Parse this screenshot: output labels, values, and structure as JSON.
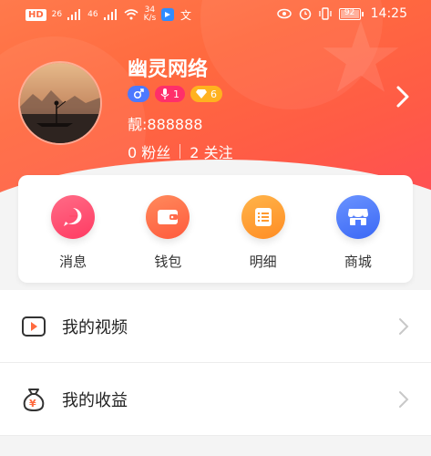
{
  "status_bar": {
    "hd_label": "HD",
    "net1_label": "26",
    "net2_label": "46",
    "speed_value": "34",
    "speed_unit": "K/s",
    "battery": "92",
    "time": "14:25"
  },
  "profile": {
    "name": "幽灵网络",
    "level_badge": "1",
    "wealth_badge": "6",
    "pretty_id": "靓:888888",
    "fans_count": "0",
    "fans_label": "粉丝",
    "follow_count": "2",
    "follow_label": "关注"
  },
  "actions": [
    {
      "label": "消息",
      "icon": "message-icon",
      "color": "#ff4d6d"
    },
    {
      "label": "钱包",
      "icon": "wallet-icon",
      "color": "#ff6a4a"
    },
    {
      "label": "明细",
      "icon": "detail-icon",
      "color": "#ff9a2f"
    },
    {
      "label": "商城",
      "icon": "shop-icon",
      "color": "#4d79ff"
    }
  ],
  "menu": [
    {
      "label": "我的视频",
      "icon": "video-icon"
    },
    {
      "label": "我的收益",
      "icon": "money-bag-icon"
    }
  ],
  "colors": {
    "header_start": "#ff7a4c",
    "header_end": "#ff4e55"
  }
}
